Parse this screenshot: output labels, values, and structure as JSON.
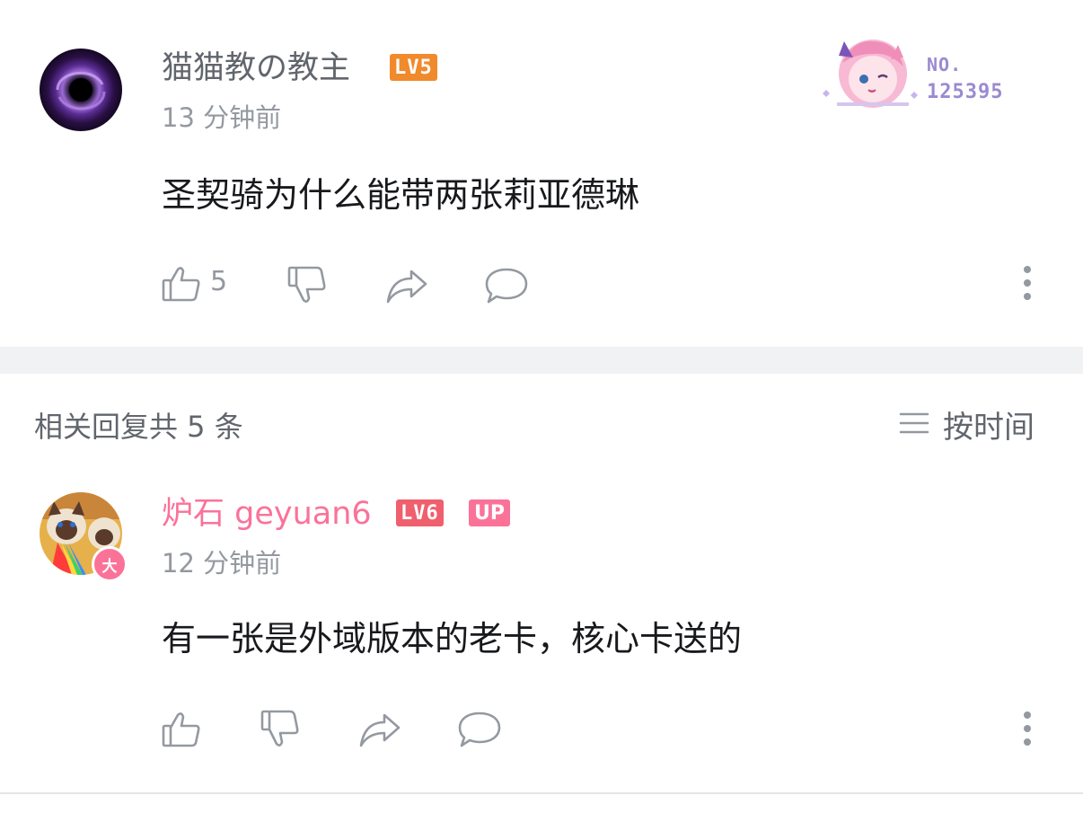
{
  "main_comment": {
    "username": "猫猫教の教主",
    "level": "LV5",
    "time": "13 分钟前",
    "content": "圣契骑为什么能带两张莉亚德琳",
    "like_count": "5",
    "fan_badge_no_label": "NO.",
    "fan_badge_number": "125395"
  },
  "replies_header": {
    "label": "相关回复共 5 条",
    "sort_label": "按时间"
  },
  "reply": {
    "username": "炉石 geyuan6",
    "level": "LV6",
    "up_badge": "UP",
    "avatar_badge": "大",
    "time": "12 分钟前",
    "content": "有一张是外域版本的老卡，核心卡送的"
  },
  "colors": {
    "lv5": "#f08a2c",
    "lv6": "#ef5f6d",
    "pink": "#fb7299",
    "gray_text": "#9499a0",
    "divider": "#f1f2f3"
  }
}
